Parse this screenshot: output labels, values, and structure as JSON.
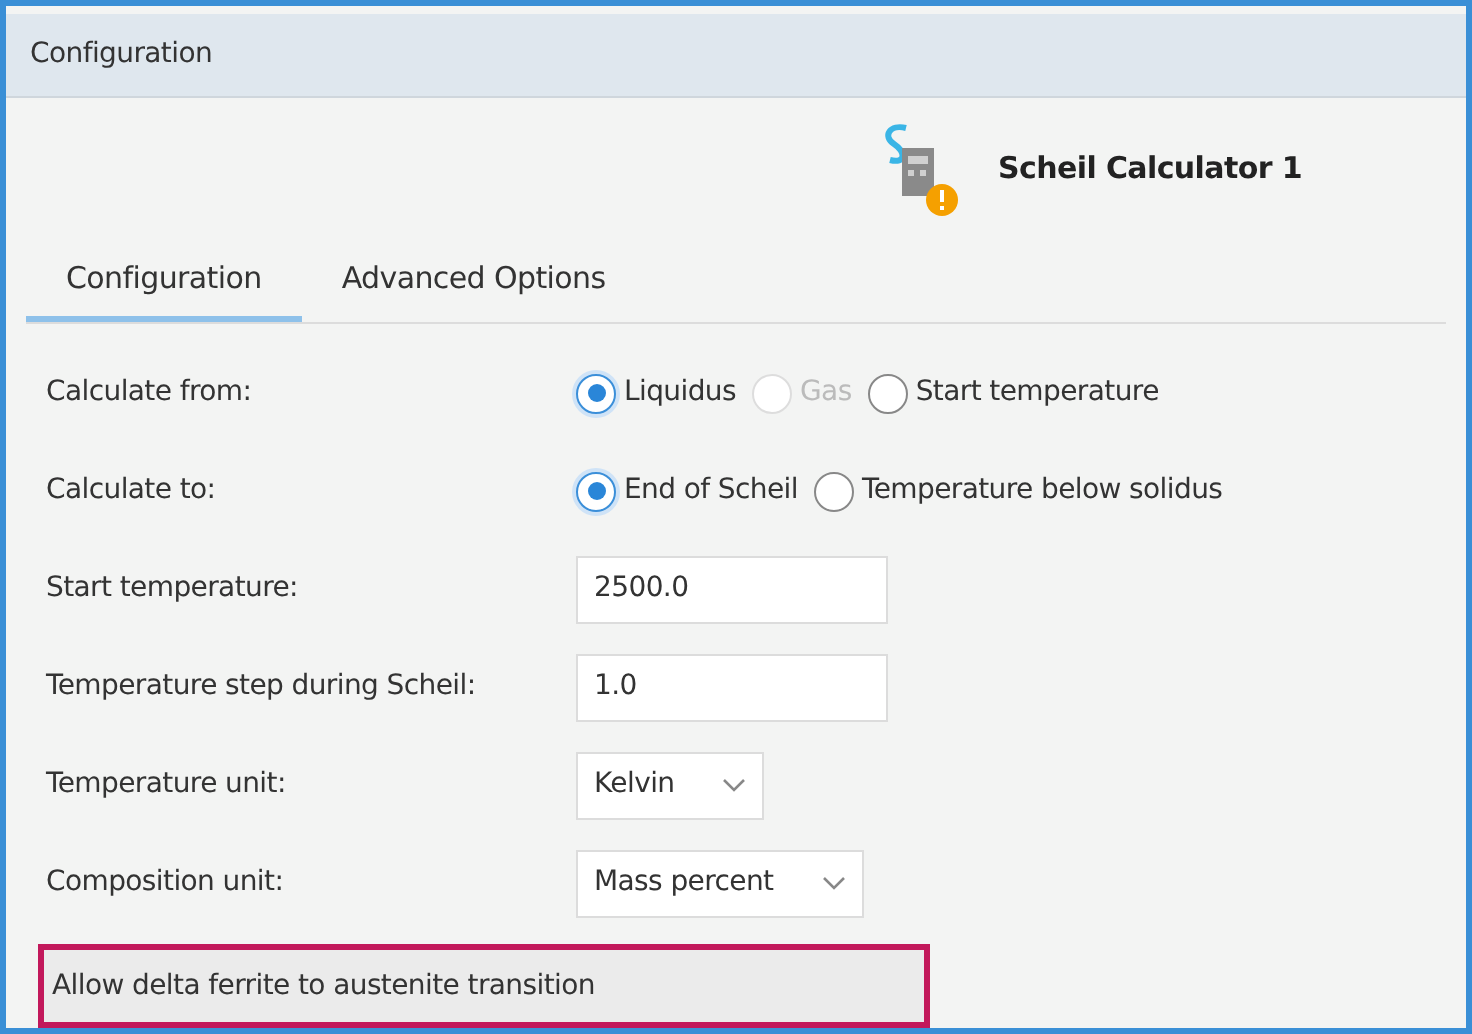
{
  "panel": {
    "title": "Configuration"
  },
  "header": {
    "name": "Scheil Calculator 1"
  },
  "tabs": [
    {
      "label": "Configuration",
      "selected": true
    },
    {
      "label": "Advanced Options",
      "selected": false
    }
  ],
  "rows": [
    {
      "kind": "radio",
      "label": "Calculate from:",
      "options": [
        {
          "label": "Liquidus",
          "selected": true,
          "disabled": false
        },
        {
          "label": "Gas",
          "selected": false,
          "disabled": true
        },
        {
          "label": "Start temperature",
          "selected": false,
          "disabled": false
        }
      ]
    },
    {
      "kind": "radio",
      "label": "Calculate to:",
      "options": [
        {
          "label": "End of Scheil",
          "selected": true,
          "disabled": false
        },
        {
          "label": "Temperature below solidus",
          "selected": false,
          "disabled": false
        }
      ]
    },
    {
      "kind": "text",
      "label": "Start temperature:",
      "value": "2500.0"
    },
    {
      "kind": "text",
      "label": "Temperature step during Scheil:",
      "value": "1.0"
    },
    {
      "kind": "select",
      "label": "Temperature unit:",
      "value": "Kelvin"
    },
    {
      "kind": "select",
      "label": "Composition unit:",
      "value": "Mass percent"
    },
    {
      "kind": "highlight",
      "label": "Allow delta ferrite to austenite transition"
    }
  ]
}
